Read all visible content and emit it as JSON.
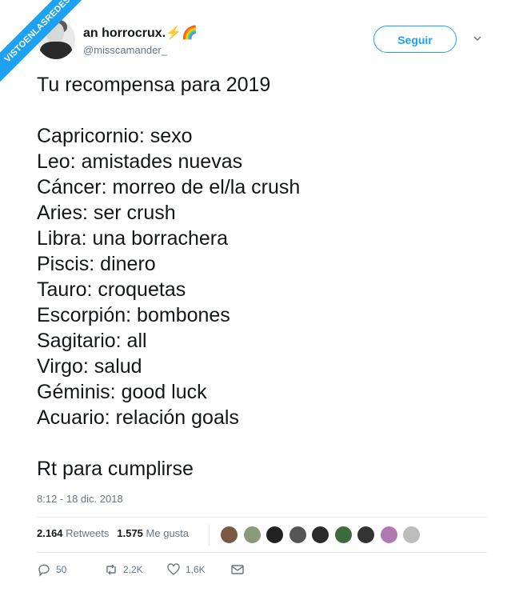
{
  "watermark": "VISTOENLASREDES",
  "user": {
    "name": "an horrocrux.",
    "name_emoji": "⚡🌈",
    "handle": "@misscamander_"
  },
  "follow_button": "Seguir",
  "tweet": {
    "text": "Tu recompensa para 2019\n\nCapricornio: sexo\nLeo: amistades nuevas\nCáncer: morreo de el/la crush\nAries: ser crush\nLibra: una borrachera\nPiscis: dinero\nTauro: croquetas\nEscorpión: bombones\nSagitario: all\nVirgo: salud\nGéminis: good luck\nAcuario: relación goals\n\nRt para cumplirse",
    "timestamp": "8:12 - 18 dic. 2018"
  },
  "stats": {
    "retweets_count": "2.164",
    "retweets_label": "Retweets",
    "likes_count": "1.575",
    "likes_label": "Me gusta"
  },
  "liker_avatars": [
    "#7a5a44",
    "#8a9a7a",
    "#222222",
    "#555555",
    "#2b2b2b",
    "#3f6a3f",
    "#333333",
    "#b07ab0",
    "#bdbdbd"
  ],
  "actions": {
    "replies": "50",
    "retweets": "2,2K",
    "likes": "1,6K"
  },
  "colors": {
    "accent": "#1da1f2",
    "muted": "#657786"
  }
}
